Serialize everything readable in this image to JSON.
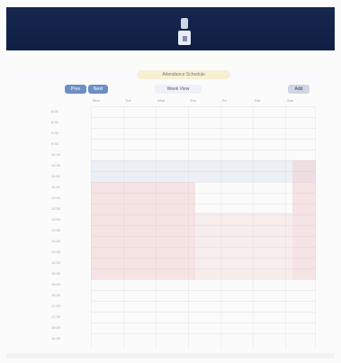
{
  "header": {
    "title": "Attendance Schedule"
  },
  "controls": {
    "left_1": "Prev",
    "left_2": "Next",
    "center": "Week View",
    "right": "Add"
  },
  "days": [
    "Mon",
    "Tue",
    "Wed",
    "Thu",
    "Fri",
    "Sat",
    "Sun"
  ],
  "times": [
    "8:00",
    "8:30",
    "9:00",
    "9:30",
    "10:00",
    "10:30",
    "11:00",
    "11:30",
    "12:00",
    "12:30",
    "13:00",
    "13:30",
    "14:00",
    "14:30",
    "15:00",
    "15:30",
    "16:00",
    "16:30",
    "17:00",
    "17:30",
    "18:00",
    "18:30"
  ]
}
